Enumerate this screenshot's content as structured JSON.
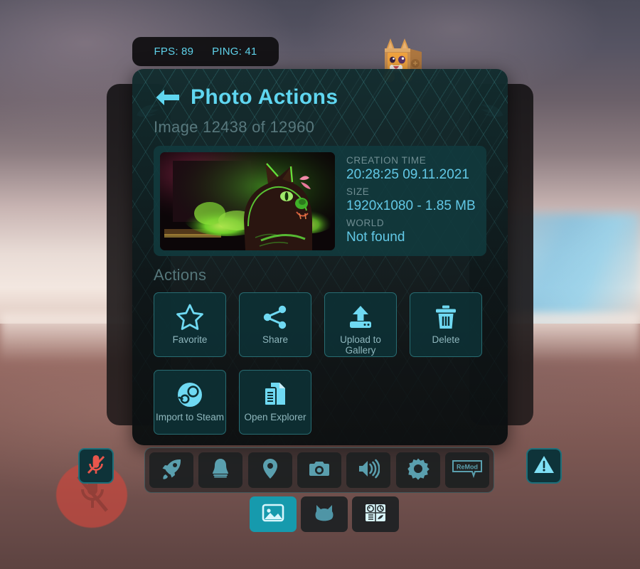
{
  "hud": {
    "fps_label": "FPS: 89",
    "ping_label": "PING: 41",
    "accent_color": "#5fd2ea"
  },
  "panel": {
    "title": "Photo Actions",
    "back_icon": "back-arrow-icon",
    "subtitle": "Image 12438 of 12960",
    "title_color": "#5fd6f0",
    "subtitle_color": "#58787d"
  },
  "info_card": {
    "thumbnail_alt": "photo-thumbnail",
    "fields": [
      {
        "label": "CREATION TIME",
        "value": "20:28:25 09.11.2021"
      },
      {
        "label": "SIZE",
        "value": "1920x1080 - 1.85 MB"
      },
      {
        "label": "WORLD",
        "value": "Not found"
      }
    ],
    "label_color": "#6f8d92",
    "value_color": "#62c8e6",
    "background_color": "#113a3e"
  },
  "actions": {
    "heading": "Actions",
    "items": [
      {
        "label": "Favorite",
        "icon": "star-icon"
      },
      {
        "label": "Share",
        "icon": "share-icon"
      },
      {
        "label": "Upload to Gallery",
        "icon": "upload-icon"
      },
      {
        "label": "Delete",
        "icon": "trash-icon"
      },
      {
        "label": "Import to Steam",
        "icon": "steam-icon"
      },
      {
        "label": "Open Explorer",
        "icon": "file-explorer-icon"
      }
    ],
    "button_color": "#0d3034",
    "border_color": "#2e787e",
    "icon_color": "#6fd9f2"
  },
  "toolbar": {
    "items": [
      {
        "name": "rocket-icon",
        "label": "Launch"
      },
      {
        "name": "bell-icon",
        "label": "Notifications"
      },
      {
        "name": "location-pin-icon",
        "label": "Location"
      },
      {
        "name": "camera-icon",
        "label": "Camera"
      },
      {
        "name": "speaker-icon",
        "label": "Audio"
      },
      {
        "name": "gear-icon",
        "label": "Settings"
      },
      {
        "name": "remod-icon",
        "label": "ReMod"
      }
    ],
    "remod_text": "ReMod"
  },
  "tabs": {
    "items": [
      {
        "name": "tab-photos",
        "icon": "image-icon",
        "active": true
      },
      {
        "name": "tab-avatar",
        "icon": "cat-head-icon",
        "active": false
      },
      {
        "name": "tab-emoji",
        "icon": "emoji-grid-icon",
        "active": false
      }
    ],
    "active_color": "#169aad"
  },
  "mic": {
    "name": "mic-muted-button",
    "state": "muted",
    "glow_color": "#c8483e",
    "icon_color": "#e8564c"
  },
  "warning": {
    "name": "warning-button",
    "icon": "warning-triangle-icon",
    "icon_color": "#7fe0f5"
  },
  "side_panels": {
    "left_icon": "wing-icon",
    "right_icon": "wing-icon",
    "icon_color": "#5fd6f0"
  }
}
